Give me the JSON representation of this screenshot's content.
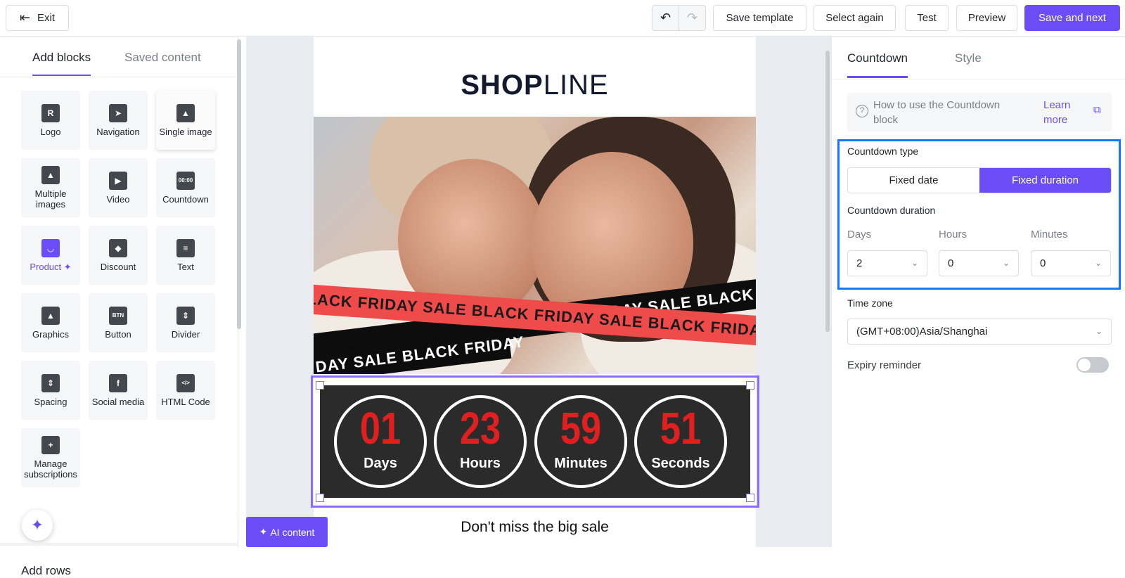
{
  "topbar": {
    "exit_label": "Exit",
    "undo_icon": "undo-icon",
    "redo_icon": "redo-icon",
    "save_template_label": "Save template",
    "select_again_label": "Select again",
    "test_label": "Test",
    "preview_label": "Preview",
    "save_next_label": "Save and next",
    "accent_color": "#6a4df4"
  },
  "left_panel": {
    "tabs": [
      "Add blocks",
      "Saved content"
    ],
    "blocks": [
      {
        "label": "Logo",
        "icon": "logo-icon",
        "glyph": "R"
      },
      {
        "label": "Navigation",
        "icon": "navigation-icon",
        "glyph": "➤"
      },
      {
        "label": "Single image",
        "icon": "image-icon",
        "glyph": "▲"
      },
      {
        "label": "Multiple images",
        "icon": "multiple-images-icon",
        "glyph": "▲"
      },
      {
        "label": "Video",
        "icon": "video-icon",
        "glyph": "▶"
      },
      {
        "label": "Countdown",
        "icon": "countdown-icon",
        "glyph": "00:00"
      },
      {
        "label": "Product ✦",
        "icon": "product-bag-icon",
        "glyph": "◡"
      },
      {
        "label": "Discount",
        "icon": "discount-tag-icon",
        "glyph": "◆"
      },
      {
        "label": "Text",
        "icon": "text-icon",
        "glyph": "≡"
      },
      {
        "label": "Graphics",
        "icon": "graphics-icon",
        "glyph": "▲"
      },
      {
        "label": "Button",
        "icon": "button-icon",
        "glyph": "BTN"
      },
      {
        "label": "Divider",
        "icon": "divider-icon",
        "glyph": "⇕"
      },
      {
        "label": "Spacing",
        "icon": "spacing-icon",
        "glyph": "⇕"
      },
      {
        "label": "Social media",
        "icon": "facebook-icon",
        "glyph": "f"
      },
      {
        "label": "HTML Code",
        "icon": "html-code-icon",
        "glyph": "</>"
      },
      {
        "label": "Manage subscriptions",
        "icon": "bookmark-plus-icon",
        "glyph": "+"
      }
    ],
    "add_rows_label": "Add rows"
  },
  "canvas": {
    "logo_bold": "SHOP",
    "logo_thin": "LINE",
    "banner_text_red": "LACK FRIDAY SALE BLACK FRIDAY SALE BLACK FRIDAY SALE BLACK FRIDAY SAL",
    "banner_text_black_top": "K FRIDAY SALE BLACK F",
    "banner_text_black_bottom": "DAY SALE BLACK FRIDAY",
    "countdown": [
      {
        "value": "01",
        "unit": "Days"
      },
      {
        "value": "23",
        "unit": "Hours"
      },
      {
        "value": "59",
        "unit": "Minutes"
      },
      {
        "value": "51",
        "unit": "Seconds"
      }
    ],
    "tagline": "Don't miss the big sale",
    "ai_content_label": "AI content"
  },
  "right_panel": {
    "tabs": [
      "Countdown",
      "Style"
    ],
    "help_text": "How to use the Countdown block",
    "learn_more": "Learn more",
    "countdown_type_label": "Countdown type",
    "type_options": [
      "Fixed date",
      "Fixed duration"
    ],
    "selected_type": "Fixed duration",
    "duration_label": "Countdown duration",
    "days_label": "Days",
    "hours_label": "Hours",
    "minutes_label": "Minutes",
    "days_value": "2",
    "hours_value": "0",
    "minutes_value": "0",
    "timezone_label": "Time zone",
    "timezone_value": "(GMT+08:00)Asia/Shanghai",
    "expiry_label": "Expiry reminder",
    "expiry_enabled": false
  }
}
